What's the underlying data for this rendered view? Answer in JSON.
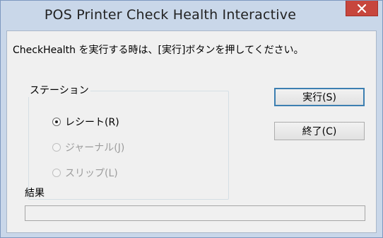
{
  "window": {
    "title": "POS Printer Check Health Interactive"
  },
  "instruction": "CheckHealth を実行する時は、[実行]ボタンを押してください。",
  "station": {
    "legend": "ステーション",
    "options": [
      {
        "label": "レシート(R)",
        "checked": true,
        "enabled": true
      },
      {
        "label": "ジャーナル(J)",
        "checked": false,
        "enabled": false
      },
      {
        "label": "スリップ(L)",
        "checked": false,
        "enabled": false
      }
    ]
  },
  "buttons": {
    "execute": "実行(S)",
    "exit": "終了(C)"
  },
  "result": {
    "label": "結果",
    "value": ""
  },
  "colors": {
    "title_bg": "#c9d7e9",
    "close_bg": "#c7463d",
    "client_bg": "#f0f0f0",
    "default_button_border": "#3c7fb1"
  }
}
